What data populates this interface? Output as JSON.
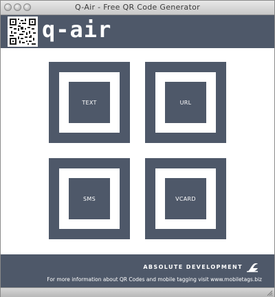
{
  "window": {
    "title": "Q-Air - Free QR Code Generator"
  },
  "header": {
    "brand": "q-air",
    "logo_icon": "qr-code-icon"
  },
  "tiles": [
    {
      "label": "TEXT"
    },
    {
      "label": "URL"
    },
    {
      "label": "SMS"
    },
    {
      "label": "VCARD"
    }
  ],
  "footer": {
    "developer": "ABSOLUTE DEVELOPMENT",
    "developer_icon": "absolute-development-logo-icon",
    "info": "For more information about QR Codes and mobile tagging visit www.mobiletags.biz"
  },
  "colors": {
    "primary": "#4e5869",
    "background": "#ffffff"
  }
}
